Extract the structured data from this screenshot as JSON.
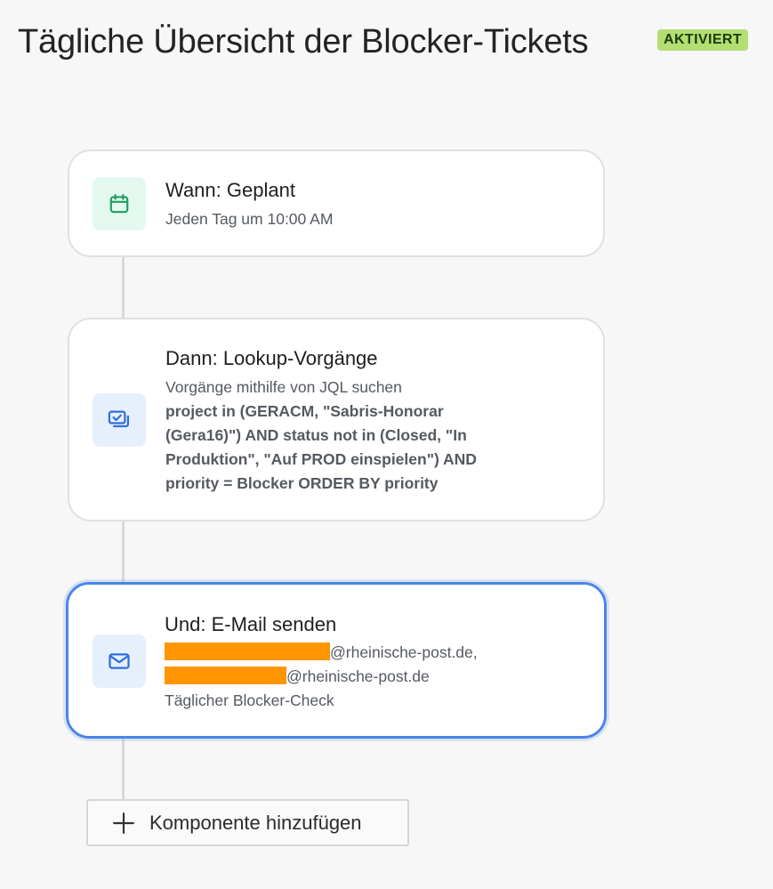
{
  "header": {
    "title": "Tägliche Übersicht der Blocker-Tickets",
    "status": "AKTIVIERT"
  },
  "colors": {
    "status_badge": "#b3df72",
    "selected_border": "#4a86e8",
    "trigger_icon": "#1f9d5f",
    "action_icon": "#2f6fdb",
    "redaction": "#ff9500"
  },
  "steps": [
    {
      "icon": "calendar-icon",
      "heading": "Wann: Geplant",
      "description": "Jeden Tag um 10:00 AM"
    },
    {
      "icon": "lookup-issues-icon",
      "heading": "Dann: Lookup-Vorgänge",
      "description": "Vorgänge mithilfe von JQL suchen",
      "query": "project in (GERACM, \"Sabris-Honorar\n(Gera16)\") AND status not in (Closed, \"In\nProduktion\", \"Auf PROD einspielen\") AND\npriority = Blocker ORDER BY priority"
    },
    {
      "icon": "envelope-icon",
      "heading": "Und: E-Mail senden",
      "recipient_1_domain": "@rheinische-post.de,",
      "recipient_2_domain": "@rheinische-post.de",
      "subject": "Täglicher Blocker-Check"
    }
  ],
  "add_component": {
    "label": "Komponente hinzufügen",
    "icon": "plus-icon"
  }
}
